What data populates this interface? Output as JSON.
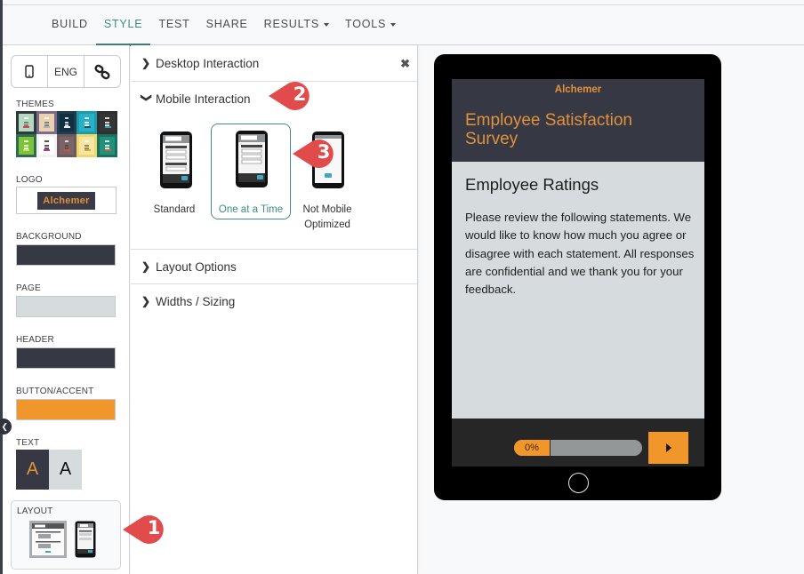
{
  "nav": {
    "tabs": [
      {
        "label": "BUILD",
        "active": false,
        "dropdown": false
      },
      {
        "label": "STYLE",
        "active": true,
        "dropdown": false
      },
      {
        "label": "TEST",
        "active": false,
        "dropdown": false
      },
      {
        "label": "SHARE",
        "active": false,
        "dropdown": false
      },
      {
        "label": "RESULTS",
        "active": false,
        "dropdown": true
      },
      {
        "label": "TOOLS",
        "active": false,
        "dropdown": true
      }
    ]
  },
  "sidebar": {
    "toolbar": {
      "device_icon": "mobile-phone-icon",
      "language_label": "ENG",
      "link_icon": "link-icon"
    },
    "themes_label": "THEMES",
    "themes": [
      {
        "bg": "#2d3a3a",
        "card": "#b6d7c2",
        "btn": "#d9434a"
      },
      {
        "bg": "#7c6a8a",
        "card": "#e9d2b1",
        "btn": "#9fb5c4"
      },
      {
        "bg": "#1f3d4a",
        "card": "#123043",
        "btn": "#e6eef1"
      },
      {
        "bg": "#1b9ab0",
        "card": "#2ab0c6",
        "btn": "#1f4f5c"
      },
      {
        "bg": "#2f2f2f",
        "card": "#353535",
        "btn": "#2aa1a8"
      },
      {
        "bg": "#2f6b50",
        "card": "#7cc23a",
        "btn": "#c2e36a"
      },
      {
        "bg": "#f2f2f2",
        "card": "#ffffff",
        "btn": "#c0348c"
      },
      {
        "bg": "#6e5a5e",
        "card": "#7a6468",
        "btn": "#d4522e"
      },
      {
        "bg": "#f1d66a",
        "card": "#f7e6a2",
        "btn": "#d9a62e"
      },
      {
        "bg": "#18705e",
        "card": "#239079",
        "btn": "#d85c35"
      }
    ],
    "logo_label": "LOGO",
    "logo_text": "Alchemer",
    "background_label": "BACKGROUND",
    "background_color": "#363844",
    "page_label": "PAGE",
    "page_color": "#d6dcde",
    "header_label": "HEADER",
    "header_color": "#363844",
    "accent_label": "BUTTON/ACCENT",
    "accent_color": "#f0962a",
    "text_label": "TEXT",
    "text_sample_dark": "A",
    "text_sample_light": "A",
    "text_color_dark_bg": "#363844",
    "text_color_accent": "#e2913b",
    "text_color_light_bg": "#d6dcde",
    "layout_label": "LAYOUT"
  },
  "panel": {
    "sections": [
      {
        "label": "Desktop Interaction",
        "expanded": false
      },
      {
        "label": "Mobile Interaction",
        "expanded": true
      },
      {
        "label": "Layout Options",
        "expanded": false
      },
      {
        "label": "Widths / Sizing",
        "expanded": false
      }
    ],
    "close_icon": "close-icon",
    "mobile_options": [
      {
        "label": "Standard",
        "selected": false
      },
      {
        "label": "One at a Time",
        "selected": true
      },
      {
        "label": "Not Mobile Optimized",
        "selected": false
      }
    ]
  },
  "callouts": [
    "1",
    "2",
    "3"
  ],
  "preview": {
    "logo": "Alchemer",
    "title": "Employee Satisfaction Survey",
    "heading": "Employee Ratings",
    "body": "Please review the following statements. We would like to know how much you agree or disagree with each statement. All responses are confidential and we thank you for your feedback.",
    "progress_percent": 0,
    "progress_label": "0%",
    "next_icon": "play-arrow-icon"
  }
}
